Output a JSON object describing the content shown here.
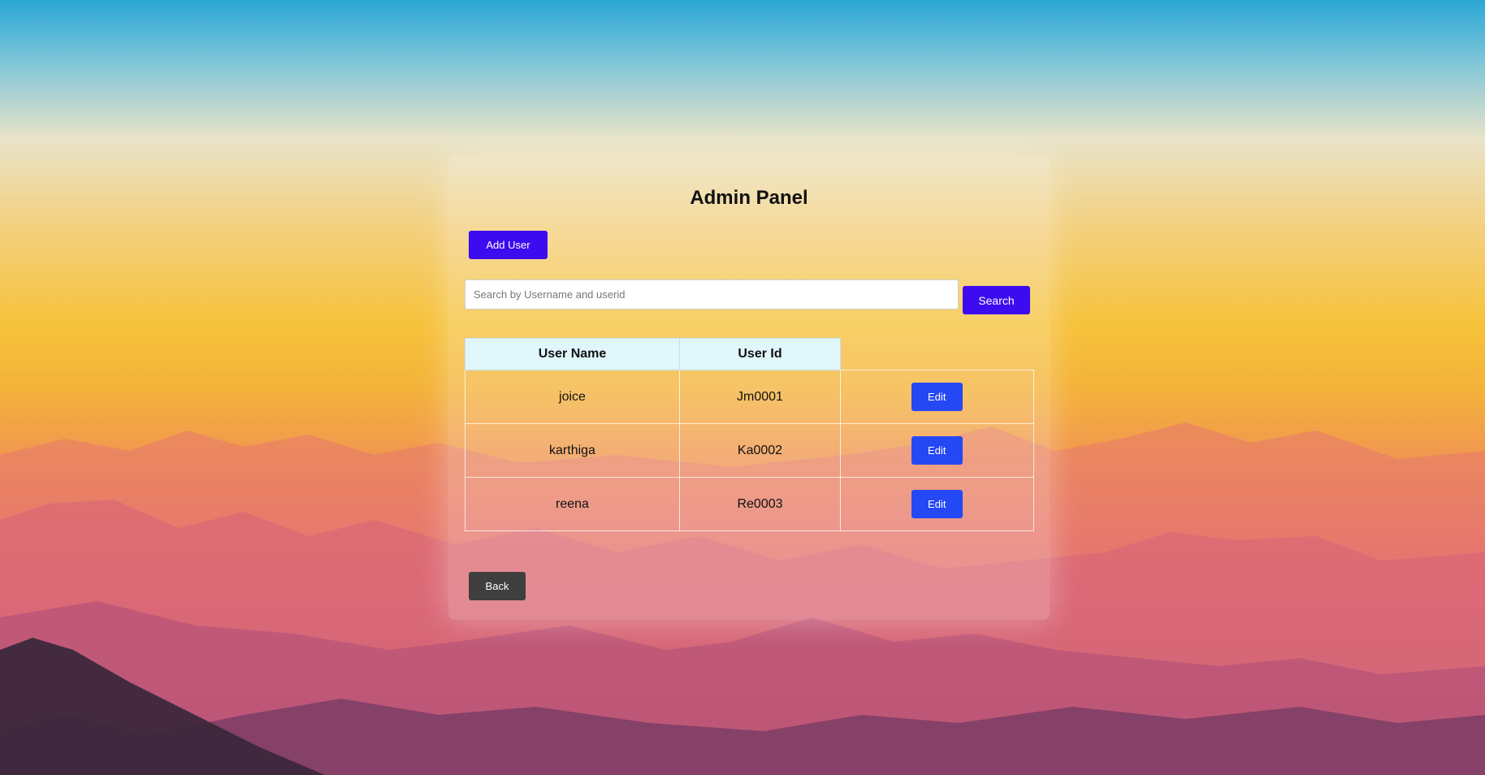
{
  "page": {
    "title": "Admin Panel"
  },
  "toolbar": {
    "add_user_label": "Add User"
  },
  "search": {
    "placeholder": "Search by Username and userid",
    "value": "",
    "button_label": "Search"
  },
  "table": {
    "headers": [
      "User Name",
      "User Id",
      ""
    ],
    "rows": [
      {
        "username": "joice",
        "userid": "Jm0001",
        "action": "Edit"
      },
      {
        "username": "karthiga",
        "userid": "Ka0002",
        "action": "Edit"
      },
      {
        "username": "reena",
        "userid": "Re0003",
        "action": "Edit"
      }
    ]
  },
  "footer": {
    "back_label": "Back"
  },
  "colors": {
    "primary_button": "#3d0bf0",
    "edit_button": "#2548f5",
    "back_button": "#3f3f3f",
    "header_bg": "#dff7fb"
  }
}
